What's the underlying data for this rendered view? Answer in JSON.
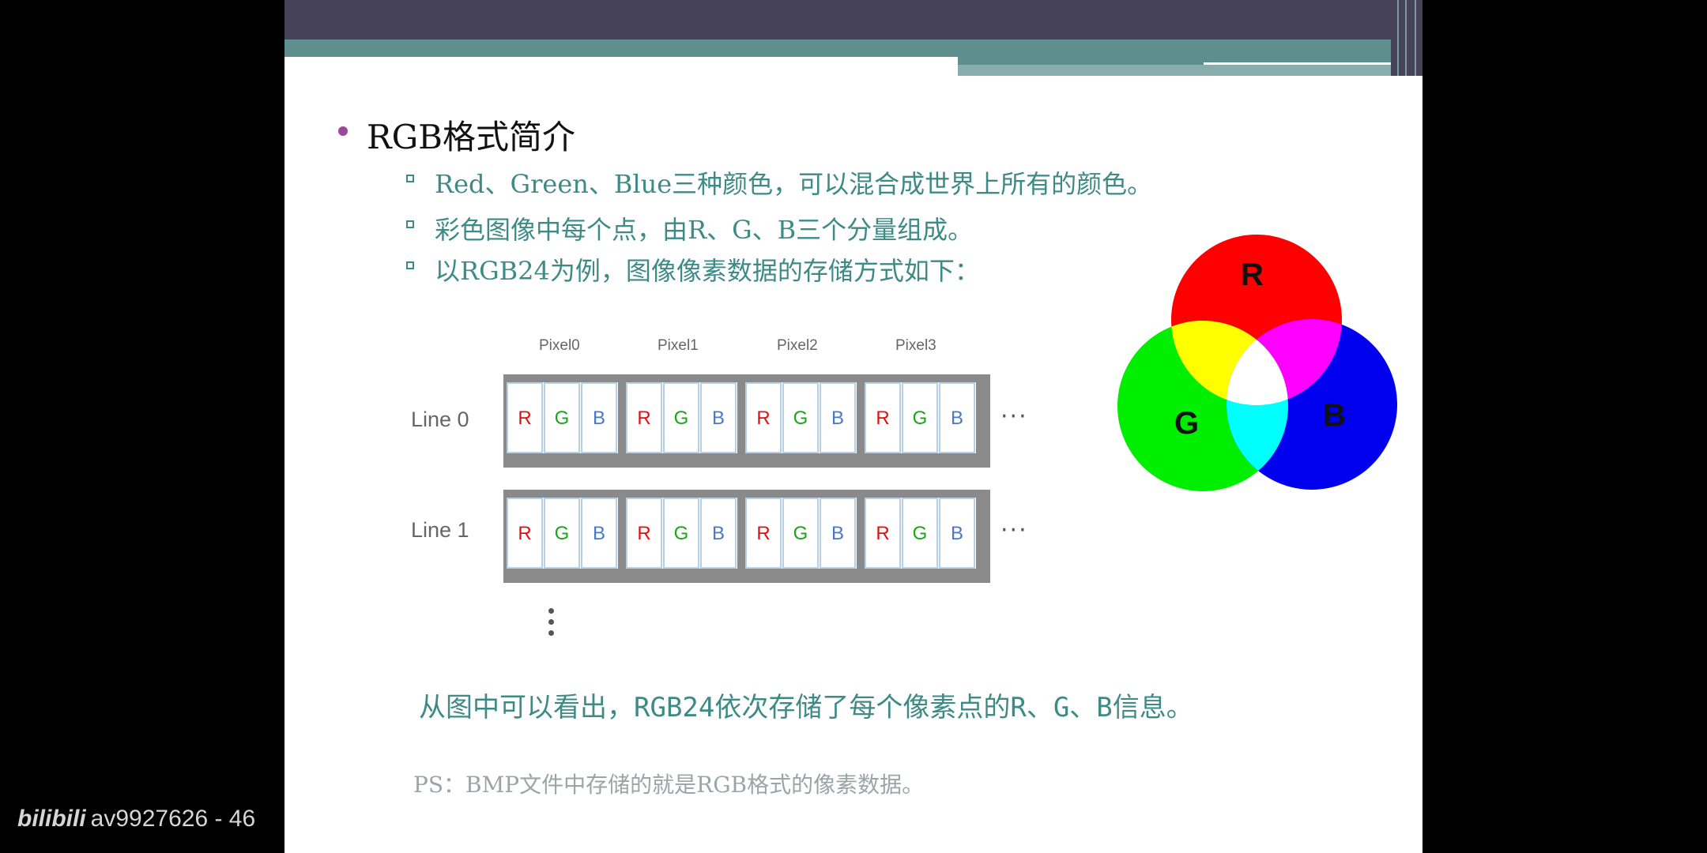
{
  "slide": {
    "title": "RGB格式简介",
    "bullets": [
      "Red、Green、Blue三种颜色，可以混合成世界上所有的颜色。",
      "彩色图像中每个点，由R、G、B三个分量组成。",
      "以RGB24为例，图像像素数据的存储方式如下："
    ],
    "diagram": {
      "pixels": [
        "Pixel0",
        "Pixel1",
        "Pixel2",
        "Pixel3"
      ],
      "lines": [
        "Line 0",
        "Line 1"
      ],
      "channels": [
        "R",
        "G",
        "B"
      ],
      "ellipsis": "···"
    },
    "venn": {
      "r": "R",
      "g": "G",
      "b": "B"
    },
    "summary": "从图中可以看出，RGB24依次存储了每个像素点的R、G、B信息。",
    "ps": "PS：BMP文件中存储的就是RGB格式的像素数据。"
  },
  "watermark": {
    "logo": "bilibili",
    "id": "av9927626 - 46"
  },
  "colors": {
    "header_dark": "#45425a",
    "header_teal": "#5e8e8e",
    "text_teal": "#3d8a86",
    "bullet_purple": "#9b4a9b"
  }
}
